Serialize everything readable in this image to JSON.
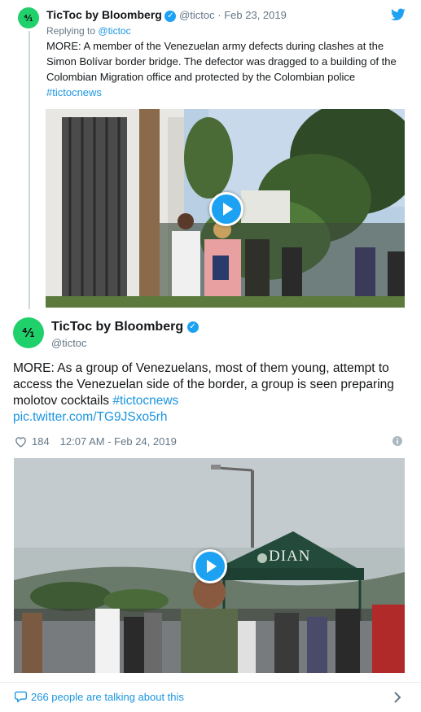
{
  "reply_tweet": {
    "avatar_text": "⁴⁄₁",
    "author_name": "TicToc by Bloomberg",
    "handle": "@tictoc",
    "separator": "·",
    "date": "Feb 23, 2019",
    "replying_label": "Replying to",
    "replying_handle": "@tictoc",
    "text": "MORE: A member of the Venezuelan army defects during clashes at the Simon Bolívar border bridge. The defector was dragged to a building of the Colombian Migration office and protected by the Colombian police",
    "hashtag": "#tictocnews"
  },
  "main_tweet": {
    "avatar_text": "⁴⁄₁",
    "author_name": "TicToc by Bloomberg",
    "handle": "@tictoc",
    "text": "MORE: As a group of Venezuelans, most of them young, attempt to access the Venezuelan side of the border, a group is seen preparing molotov cocktails",
    "hashtag": "#tictocnews",
    "media_link": "pic.twitter.com/TG9JSxo5rh",
    "like_count": "184",
    "timestamp": "12:07 AM - Feb 24, 2019",
    "tent_sign": "DIAN"
  },
  "footer": {
    "text": "266 people are talking about this"
  },
  "colors": {
    "twitter_blue": "#1da1f2",
    "link_blue": "#1b95e0",
    "avatar_green": "#1fd06b",
    "muted_gray": "#657786"
  },
  "icons": [
    "twitter-bird-icon",
    "verified-icon",
    "play-icon",
    "heart-icon",
    "info-icon",
    "speech-bubble-icon",
    "chevron-right-icon"
  ]
}
